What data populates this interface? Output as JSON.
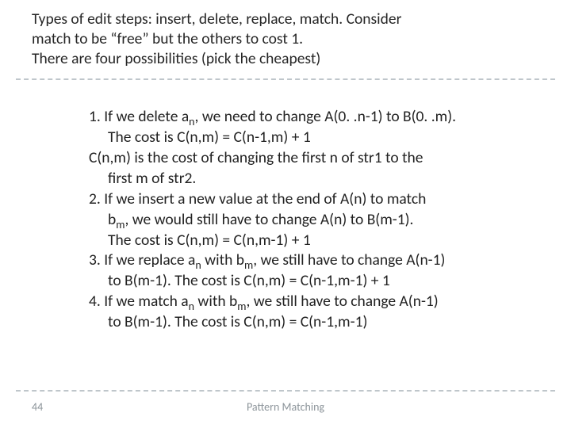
{
  "title": {
    "line1": "Types of edit steps: insert, delete, replace, match.  Consider",
    "line2": "match to be “free” but the others to cost 1.",
    "line3": "There are four possibilities (pick the cheapest)"
  },
  "body": {
    "l01a": "1.  If we delete a",
    "l01b": ", we need to change A(0. .n-1) to B(0. .m).",
    "l02": "The cost is C(n,m) = C(n-1,m) + 1",
    "l03": "C(n,m) is the cost of changing the first n of str1 to the",
    "l04": "first m of str2.",
    "l05a": "2. If we insert a new value at the end of A(n) to match",
    "l05b": "b",
    "l05c": ",  we would still have to change A(n) to B(m-1).",
    "l06": "The cost is C(n,m) = C(n,m-1) + 1",
    "l07a": "3. If we replace a",
    "l07b": " with b",
    "l07c": ", we still have to change A(n-1)",
    "l08": "to  B(m-1).  The cost is C(n,m) = C(n-1,m-1) + 1",
    "l09a": "4. If we match a",
    "l09b": " with b",
    "l09c": ", we still have to change   A(n-1)",
    "l10": "to B(m-1).  The cost is C(n,m) = C(n-1,m-1)",
    "sub_n": "n",
    "sub_m": "m"
  },
  "footer": {
    "page": "44",
    "label": "Pattern Matching"
  }
}
